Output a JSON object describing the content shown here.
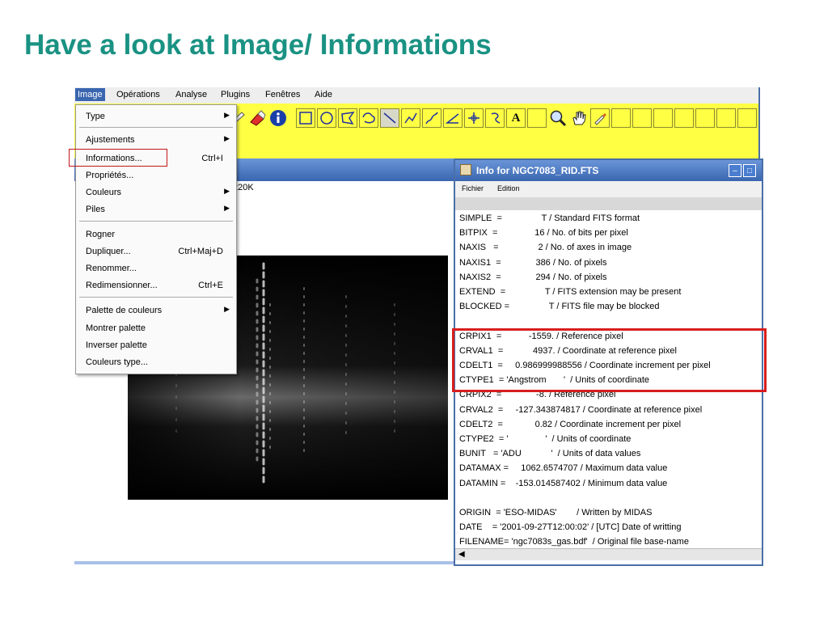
{
  "slide": {
    "title": "Have a look at Image/ Informations"
  },
  "ij_menubar": [
    "Image",
    "Opérations",
    "Analyse",
    "Plugins",
    "Fenêtres",
    "Aide"
  ],
  "image_menu": {
    "items": [
      {
        "label": "Type",
        "shortcut": "",
        "submenu": true
      },
      {
        "label": "Ajustements",
        "shortcut": "",
        "submenu": true
      },
      {
        "label": "Informations...",
        "shortcut": "Ctrl+I",
        "submenu": false
      },
      {
        "label": "Propriétés...",
        "shortcut": "",
        "submenu": false
      },
      {
        "label": "Couleurs",
        "shortcut": "",
        "submenu": true
      },
      {
        "label": "Piles",
        "shortcut": "",
        "submenu": true
      },
      {
        "label": "Rogner",
        "shortcut": "",
        "submenu": false
      },
      {
        "label": "Dupliquer...",
        "shortcut": "Ctrl+Maj+D",
        "submenu": false
      },
      {
        "label": "Renommer...",
        "shortcut": "",
        "submenu": false
      },
      {
        "label": "Redimensionner...",
        "shortcut": "Ctrl+E",
        "submenu": false
      },
      {
        "label": "Palette de couleurs",
        "shortcut": "",
        "submenu": true
      },
      {
        "label": "Montrer palette",
        "shortcut": "",
        "submenu": false
      },
      {
        "label": "Inverser palette",
        "shortcut": "",
        "submenu": false
      },
      {
        "label": "Couleurs type...",
        "shortcut": "",
        "submenu": false
      }
    ]
  },
  "image_window": {
    "subtitle": "220K"
  },
  "info_window": {
    "title": "Info for NGC7083_RID.FTS",
    "menu": [
      "Fichier",
      "Edition"
    ],
    "lines": [
      "SIMPLE  =                T / Standard FITS format",
      "BITPIX  =               16 / No. of bits per pixel",
      "NAXIS   =                2 / No. of axes in image",
      "NAXIS1  =              386 / No. of pixels",
      "NAXIS2  =              294 / No. of pixels",
      "EXTEND  =                T / FITS extension may be present",
      "BLOCKED =                T / FITS file may be blocked",
      "",
      "CRPIX1  =           -1559. / Reference pixel",
      "CRVAL1  =            4937. / Coordinate at reference pixel",
      "CDELT1  =     0.986999988556 / Coordinate increment per pixel",
      "CTYPE1  = 'Angstrom       '  / Units of coordinate",
      "CRPIX2  =              -8. / Reference pixel",
      "CRVAL2  =     -127.343874817 / Coordinate at reference pixel",
      "CDELT2  =             0.82 / Coordinate increment per pixel",
      "CTYPE2  = '               '  / Units of coordinate",
      "BUNIT   = 'ADU            '  / Units of data values",
      "DATAMAX =     1062.6574707 / Maximum data value",
      "DATAMIN =    -153.014587402 / Minimum data value",
      "",
      "ORIGIN  = 'ESO-MIDAS'        / Written by MIDAS",
      "DATE    = '2001-09-27T12:00:02' / [UTC] Date of writting",
      "FILENAME= 'ngc7083s_gas.bdf'  / Original file base-name"
    ]
  },
  "colors": {
    "title": "#1a9283",
    "toolbar": "#ffff44",
    "highlight": "#d81e1e",
    "window_blue": "#3a66b0"
  }
}
